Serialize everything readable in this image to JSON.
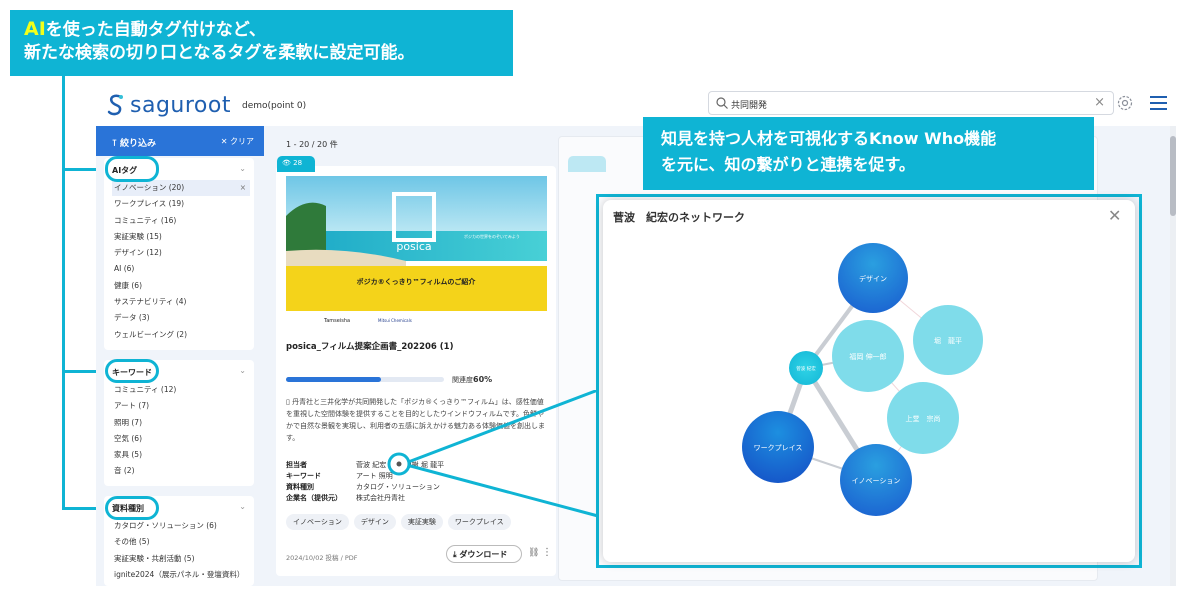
{
  "callout_top": {
    "ai": "AI",
    "line1": "を使った自動タグ付けなど、",
    "line2": "新たな検索の切り口となるタグを柔軟に設定可能。"
  },
  "callout_right": {
    "line1": "知見を持つ人材を可視化するKnow Who機能",
    "line2": "を元に、知の繋がりと連携を促す。"
  },
  "app": {
    "logo": "saguroot",
    "user": "demo(point 0)"
  },
  "search": {
    "value": "共同開発",
    "clear": "×"
  },
  "sidebar": {
    "title": "絞り込み",
    "clear": "クリア",
    "ai_tags": {
      "header": "AIタグ",
      "items": [
        "イノベーション (20)",
        "ワークプレイス (19)",
        "コミュニティ (16)",
        "実証実験 (15)",
        "デザイン (12)",
        "AI (6)",
        "健康 (6)",
        "サステナビリティ (4)",
        "データ (3)",
        "ウェルビーイング (2)"
      ]
    },
    "keywords": {
      "header": "キーワード",
      "items": [
        "コミュニティ (12)",
        "アート (7)",
        "照明 (7)",
        "空気 (6)",
        "家具 (5)",
        "音 (2)"
      ]
    },
    "doc_types": {
      "header": "資料種別",
      "items": [
        "カタログ・ソリューション (6)",
        "その他 (5)",
        "実証実験・共創活動 (5)",
        "ignite2024（展示パネル・登壇資料）"
      ]
    }
  },
  "results": {
    "count": "1 - 20 / 20 件"
  },
  "card": {
    "views": "28",
    "thumb_logo": "posica",
    "thumb_tagline": "ポジカの世界をのぞいてみよう",
    "thumb_banner": "ポジカ®くっきり™フィルムのご紹介",
    "thumb_co1": "Tamseisha",
    "thumb_co2": "Mitsui Chemicals",
    "title": "posica_フィルム提案企画書_202206 (1)",
    "relevance": 0.6,
    "relevance_label": "関連度",
    "relevance_value": "60%",
    "description": "丹青社と三井化学が共同開発した「ポジカ®くっきり™フィルム」は、感性価値を重視した空間体験を提供することを目的としたウインドウフィルムです。色鮮やかで自然な景観を実現し、利用者の五感に訴えかける魅力ある体験価値を創出します。",
    "meta": [
      {
        "k": "担当者",
        "v": "菅波 紀宏  福田 博樹  堀 龍平"
      },
      {
        "k": "キーワード",
        "v": "アート  照明"
      },
      {
        "k": "資料種別",
        "v": "カタログ・ソリューション"
      },
      {
        "k": "企業名（提供元）",
        "v": "株式会社丹青社"
      }
    ],
    "tags": [
      "イノベーション",
      "デザイン",
      "実証実験",
      "ワークプレイス"
    ],
    "footer": "2024/10/02 投稿  /  PDF",
    "download": "ダウンロード"
  },
  "modal": {
    "title": "菅波　紀宏のネットワーク",
    "nodes": [
      "デザイン",
      "堀　龍平",
      "福岡 伸一郎",
      "菅波 紀宏",
      "上堂　宗尚",
      "ワークプレイス",
      "イノベーション"
    ]
  },
  "colors": {
    "accent": "#0fb4d4",
    "brand": "#2a74d8",
    "highlight_yellow": "#f2ff1a"
  }
}
